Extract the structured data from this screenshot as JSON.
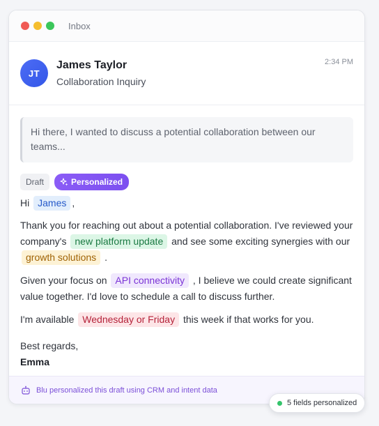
{
  "window": {
    "title": "Inbox"
  },
  "email": {
    "avatar_initials": "JT",
    "sender_name": "James Taylor",
    "subject": "Collaboration Inquiry",
    "time": "2:34 PM",
    "quoted_message": "Hi there, I wanted to discuss a potential collaboration between our teams..."
  },
  "badges": {
    "draft": "Draft",
    "personalized": "Personalized"
  },
  "draft": {
    "greeting_prefix": "Hi",
    "greeting_name": "James",
    "greeting_suffix": ",",
    "p1_a": "Thank you for reaching out about a potential collaboration. I've reviewed your company's",
    "p1_token1": "new platform update",
    "p1_b": "and see some exciting synergies with our",
    "p1_token2": "growth solutions",
    "p1_c": ".",
    "p2_a": "Given your focus on",
    "p2_token": "API connectivity",
    "p2_b": ", I believe we could create significant value together. I'd love to schedule a call to discuss further.",
    "p3_a": "I'm available",
    "p3_token": "Wednesday or Friday",
    "p3_b": "this week if that works for you.",
    "closing": "Best regards,",
    "signature": "Emma"
  },
  "footer": {
    "text": "Blu personalized this draft using CRM and intent data"
  },
  "status_pill": {
    "text": "5 fields personalized"
  },
  "colors": {
    "accent_purple": "#8b5cf6",
    "avatar_blue": "#3d5cf0",
    "status_green": "#34c46b"
  },
  "icons": [
    "sparkle-icon",
    "bot-icon"
  ]
}
